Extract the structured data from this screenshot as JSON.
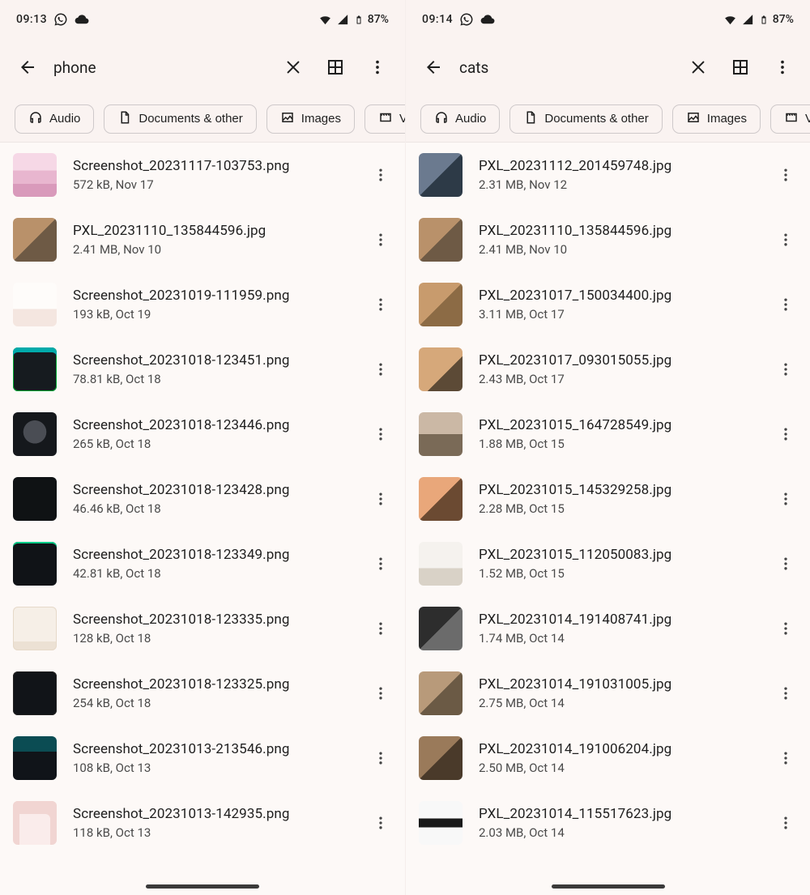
{
  "screens": [
    {
      "status": {
        "time": "09:13",
        "battery": "87%"
      },
      "search": {
        "query": "phone"
      },
      "chips": [
        {
          "icon": "headphones",
          "label": "Audio"
        },
        {
          "icon": "doc",
          "label": "Documents & other"
        },
        {
          "icon": "image",
          "label": "Images"
        },
        {
          "icon": "video",
          "label": "Vi"
        }
      ],
      "files": [
        {
          "name": "Screenshot_20231117-103753.png",
          "size": "572 kB",
          "date": "Nov 17",
          "th": "th-pink"
        },
        {
          "name": "PXL_20231110_135844596.jpg",
          "size": "2.41 MB",
          "date": "Nov 10",
          "th": "th-cat"
        },
        {
          "name": "Screenshot_20231019-111959.png",
          "size": "193 kB",
          "date": "Oct 19",
          "th": "th-light"
        },
        {
          "name": "Screenshot_20231018-123451.png",
          "size": "78.81 kB",
          "date": "Oct 18",
          "th": "th-dark"
        },
        {
          "name": "Screenshot_20231018-123446.png",
          "size": "265 kB",
          "date": "Oct 18",
          "th": "th-dark2"
        },
        {
          "name": "Screenshot_20231018-123428.png",
          "size": "46.46 kB",
          "date": "Oct 18",
          "th": "th-black"
        },
        {
          "name": "Screenshot_20231018-123349.png",
          "size": "42.81 kB",
          "date": "Oct 18",
          "th": "th-dark3"
        },
        {
          "name": "Screenshot_20231018-123335.png",
          "size": "128 kB",
          "date": "Oct 18",
          "th": "th-paper"
        },
        {
          "name": "Screenshot_20231018-123325.png",
          "size": "254 kB",
          "date": "Oct 18",
          "th": "th-text"
        },
        {
          "name": "Screenshot_20231013-213546.png",
          "size": "108 kB",
          "date": "Oct 13",
          "th": "th-teal"
        },
        {
          "name": "Screenshot_20231013-142935.png",
          "size": "118 kB",
          "date": "Oct 13",
          "th": "th-chat"
        }
      ]
    },
    {
      "status": {
        "time": "09:14",
        "battery": "87%"
      },
      "search": {
        "query": "cats"
      },
      "chips": [
        {
          "icon": "headphones",
          "label": "Audio"
        },
        {
          "icon": "doc",
          "label": "Documents & other"
        },
        {
          "icon": "image",
          "label": "Images"
        },
        {
          "icon": "video",
          "label": "Vi"
        }
      ],
      "files": [
        {
          "name": "PXL_20231112_201459748.jpg",
          "size": "2.31 MB",
          "date": "Nov 12",
          "th": "th-photo1"
        },
        {
          "name": "PXL_20231110_135844596.jpg",
          "size": "2.41 MB",
          "date": "Nov 10",
          "th": "th-cat"
        },
        {
          "name": "PXL_20231017_150034400.jpg",
          "size": "3.11 MB",
          "date": "Oct 17",
          "th": "th-photo2"
        },
        {
          "name": "PXL_20231017_093015055.jpg",
          "size": "2.43 MB",
          "date": "Oct 17",
          "th": "th-photo3"
        },
        {
          "name": "PXL_20231015_164728549.jpg",
          "size": "1.88 MB",
          "date": "Oct 15",
          "th": "th-photo4"
        },
        {
          "name": "PXL_20231015_145329258.jpg",
          "size": "2.28 MB",
          "date": "Oct 15",
          "th": "th-photo5"
        },
        {
          "name": "PXL_20231015_112050083.jpg",
          "size": "1.52 MB",
          "date": "Oct 15",
          "th": "th-photo6"
        },
        {
          "name": "PXL_20231014_191408741.jpg",
          "size": "1.74 MB",
          "date": "Oct 14",
          "th": "th-photo7"
        },
        {
          "name": "PXL_20231014_191031005.jpg",
          "size": "2.75 MB",
          "date": "Oct 14",
          "th": "th-photo8"
        },
        {
          "name": "PXL_20231014_191006204.jpg",
          "size": "2.50 MB",
          "date": "Oct 14",
          "th": "th-photo9"
        },
        {
          "name": "PXL_20231014_115517623.jpg",
          "size": "2.03 MB",
          "date": "Oct 14",
          "th": "th-photo10"
        }
      ]
    }
  ]
}
